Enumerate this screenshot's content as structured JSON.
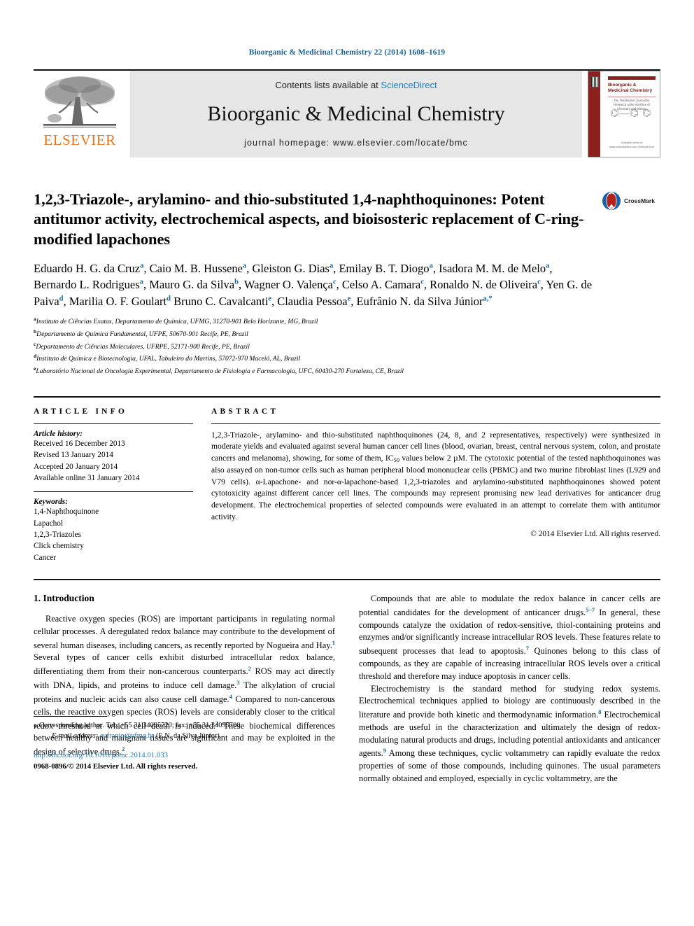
{
  "running_head": "Bioorganic & Medicinal Chemistry 22 (2014) 1608–1619",
  "masthead": {
    "publisher": "ELSEVIER",
    "contents_prefix": "Contents lists available at ",
    "contents_link": "ScienceDirect",
    "journal_name": "Bioorganic & Medicinal Chemistry",
    "homepage": "journal homepage: www.elsevier.com/locate/bmc",
    "cover": {
      "title": "Bioorganic & Medicinal Chemistry",
      "subtitle": "The Tetrahedron Journal for Research at the Interface of Chemistry and Biology",
      "footer": "Available online at www.sciencedirect.com ScienceDirect"
    }
  },
  "article": {
    "title": "1,2,3-Triazole-, arylamino- and thio-substituted 1,4-naphthoquinones: Potent antitumor activity, electrochemical aspects, and bioisosteric replacement of C-ring-modified lapachones",
    "crossmark_label": "CrossMark",
    "authors": [
      {
        "name": "Eduardo H. G. da Cruz",
        "marks": "a",
        "sep": ", "
      },
      {
        "name": "Caio M. B. Hussene",
        "marks": "a",
        "sep": ", "
      },
      {
        "name": "Gleiston G. Dias",
        "marks": "a",
        "sep": ", "
      },
      {
        "name": "Emilay B. T. Diogo",
        "marks": "a",
        "sep": ", "
      },
      {
        "name": "Isadora M. M. de Melo",
        "marks": "a",
        "sep": ", "
      },
      {
        "name": "Bernardo L. Rodrigues",
        "marks": "a",
        "sep": ", "
      },
      {
        "name": "Mauro G. da Silva",
        "marks": "b",
        "sep": ", "
      },
      {
        "name": "Wagner O. Valença",
        "marks": "c",
        "sep": ", "
      },
      {
        "name": "Celso A. Camara",
        "marks": "c",
        "sep": ", "
      },
      {
        "name": "Ronaldo N. de Oliveira",
        "marks": "c",
        "sep": ", "
      },
      {
        "name": "Yen G. de Paiva",
        "marks": "d",
        "sep": ", "
      },
      {
        "name": "Marilia O. F. Goulart",
        "marks": "d",
        "sep": " "
      },
      {
        "name": "Bruno C. Cavalcanti",
        "marks": "e",
        "sep": ", "
      },
      {
        "name": "Claudia Pessoa",
        "marks": "e",
        "sep": ", "
      },
      {
        "name": "Eufrânio N. da Silva Júnior",
        "marks": "a,*",
        "sep": ""
      }
    ],
    "affiliations": [
      {
        "mark": "a",
        "text": "Instituto de Ciências Exatas, Departamento de Química, UFMG, 31270-901 Belo Horizonte, MG, Brazil"
      },
      {
        "mark": "b",
        "text": "Departamento de Química Fundamental, UFPE, 50670-901 Recife, PE, Brazil"
      },
      {
        "mark": "c",
        "text": "Departamento de Ciências Moleculares, UFRPE, 52171-900 Recife, PE, Brazil"
      },
      {
        "mark": "d",
        "text": "Instituto de Química e Biotecnologia, UFAL, Tabuleiro do Martins, 57072-970 Maceió, AL, Brazil"
      },
      {
        "mark": "e",
        "text": "Laboratório Nacional de Oncologia Experimental, Departamento de Fisiologia e Farmacologia, UFC, 60430-270 Fortaleza, CE, Brazil"
      }
    ]
  },
  "article_info": {
    "heading": "ARTICLE INFO",
    "history_label": "Article history:",
    "history": [
      "Received 16 December 2013",
      "Revised 13 January 2014",
      "Accepted 20 January 2014",
      "Available online 31 January 2014"
    ],
    "keywords_label": "Keywords:",
    "keywords": [
      "1,4-Naphthoquinone",
      "Lapachol",
      "1,2,3-Triazoles",
      "Click chemistry",
      "Cancer"
    ]
  },
  "abstract": {
    "heading": "ABSTRACT",
    "part1": "1,2,3-Triazole-, arylamino- and thio-substituted naphthoquinones (24, 8, and 2 representatives, respectively) were synthesized in moderate yields and evaluated against several human cancer cell lines (blood, ovarian, breast, central nervous system, colon, and prostate cancers and melanoma), showing, for some of them, IC",
    "sub": "50",
    "part2": " values below 2 µM. The cytotoxic potential of the tested naphthoquinones was also assayed on non-tumor cells such as human peripheral blood mononuclear cells (PBMC) and two murine fibroblast lines (L929 and V79 cells). α-Lapachone- and nor-α-lapachone-based 1,2,3-triazoles and arylamino-substituted naphthoquinones showed potent cytotoxicity against different cancer cell lines. The compounds may represent promising new lead derivatives for anticancer drug development. The electrochemical properties of selected compounds were evaluated in an attempt to correlate them with antitumor activity.",
    "copyright": "© 2014 Elsevier Ltd. All rights reserved."
  },
  "body": {
    "section_title": "1. Introduction",
    "left_paragraphs": [
      {
        "runs": [
          {
            "t": "Reactive oxygen species (ROS) are important participants in regulating normal cellular processes. A deregulated redox balance may contribute to the development of several human diseases, including cancers, as recently reported by Nogueira and Hay."
          },
          {
            "sup": "1"
          },
          {
            "t": " Several types of cancer cells exhibit disturbed intracellular redox balance, differentiating them from their non-cancerous counterparts."
          },
          {
            "sup": "2"
          },
          {
            "t": " ROS may act directly with DNA, lipids, and proteins to induce cell damage."
          },
          {
            "sup": "3"
          },
          {
            "t": " The alkylation of crucial proteins and nucleic acids can also cause cell damage."
          },
          {
            "sup": "4"
          },
          {
            "t": " Compared to non-cancerous cells, the reactive oxygen species (ROS) levels are considerably closer to the critical redox threshold at which cell death is induced."
          },
          {
            "sup": "2"
          },
          {
            "t": " These biochemical differences between healthy and malignant tissues are significant and may be exploited in the design of selective drugs."
          },
          {
            "sup": "2"
          }
        ]
      }
    ],
    "right_paragraphs": [
      {
        "runs": [
          {
            "t": "Compounds that are able to modulate the redox balance in cancer cells are potential candidates for the development of anticancer drugs."
          },
          {
            "sup": "5–7"
          },
          {
            "t": " In general, these compounds catalyze the oxidation of redox-sensitive, thiol-containing proteins and enzymes and/or significantly increase intracellular ROS levels. These features relate to subsequent processes that lead to apoptosis."
          },
          {
            "sup": "7"
          },
          {
            "t": " Quinones belong to this class of compounds, as they are capable of increasing intracellular ROS levels over a critical threshold and therefore may induce apoptosis in cancer cells."
          }
        ]
      },
      {
        "runs": [
          {
            "t": "Electrochemistry is the standard method for studying redox systems. Electrochemical techniques applied to biology are continuously described in the literature and provide both kinetic and thermodynamic information."
          },
          {
            "sup": "8"
          },
          {
            "t": " Electrochemical methods are useful in the characterization and ultimately the design of redox-modulating natural products and drugs, including potential antioxidants and anticancer agents."
          },
          {
            "sup": "9"
          },
          {
            "t": " Among these techniques, cyclic voltammetry can rapidly evaluate the redox properties of some of those compounds, including quinones. The usual parameters normally obtained and employed, especially in cyclic voltammetry, are the"
          }
        ]
      }
    ]
  },
  "footer": {
    "corresponding_star": "⁎",
    "corresponding_text": "Corresponding author. Tel.: +55 31 34095720; fax: +55 31 34095700.",
    "email_label": "E-mail address:",
    "email": "eufranio@ufmg.br",
    "email_suffix": " (E.N. da Silva Júnior).",
    "doi": "http://dx.doi.org/10.1016/j.bmc.2014.01.033",
    "issn": "0968-0896/© 2014 Elsevier Ltd. All rights reserved."
  },
  "colors": {
    "link": "#1a7ec2",
    "running_head": "#1a6496",
    "elsevier_orange": "#E87722",
    "cover_red": "#8d1f1f"
  }
}
